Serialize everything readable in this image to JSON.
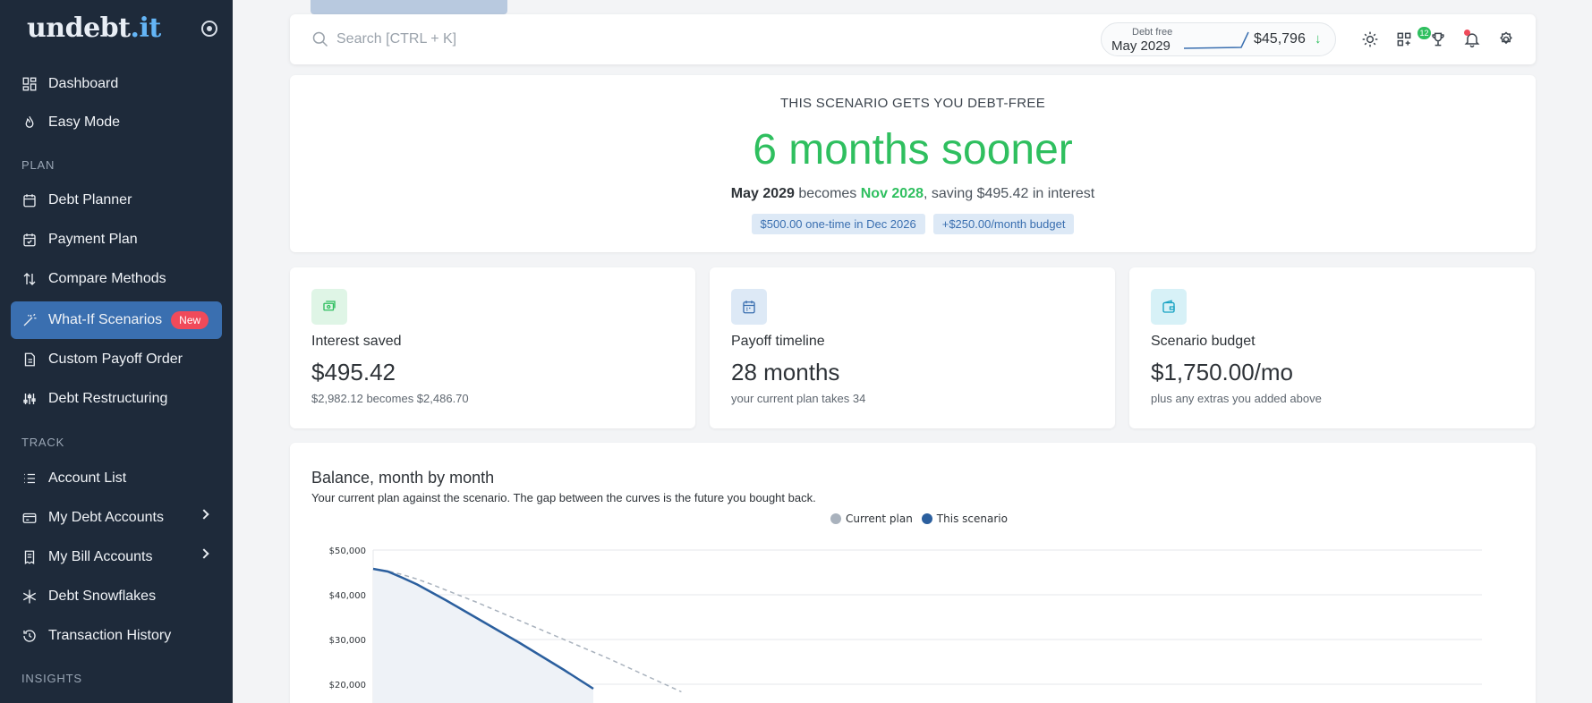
{
  "brand": {
    "name_main": "undebt",
    "name_accent": ".it"
  },
  "sidebar": {
    "items": [
      {
        "label": "Dashboard",
        "icon": "dashboard-icon"
      },
      {
        "label": "Easy Mode",
        "icon": "flame-icon"
      },
      {
        "label": "Debt Planner",
        "icon": "calendar-icon"
      },
      {
        "label": "Payment Plan",
        "icon": "calendar-check-icon"
      },
      {
        "label": "Compare Methods",
        "icon": "sort-arrows-icon"
      },
      {
        "label": "What-If Scenarios",
        "icon": "magic-wand-icon",
        "badge": "New",
        "active": true
      },
      {
        "label": "Custom Payoff Order",
        "icon": "document-icon"
      },
      {
        "label": "Debt Restructuring",
        "icon": "sliders-icon"
      },
      {
        "label": "Account List",
        "icon": "list-icon"
      },
      {
        "label": "My Debt Accounts",
        "icon": "credit-card-icon"
      },
      {
        "label": "My Bill Accounts",
        "icon": "receipt-icon"
      },
      {
        "label": "Debt Snowflakes",
        "icon": "snowflake-icon"
      },
      {
        "label": "Transaction History",
        "icon": "history-icon"
      }
    ],
    "sections": {
      "plan": "PLAN",
      "track": "TRACK",
      "insights": "INSIGHTS"
    }
  },
  "header": {
    "search_placeholder": "Search [CTRL + K]",
    "debt_free_label": "Debt free",
    "debt_free_date": "May 2029",
    "total_balance": "$45,796",
    "achievements_count": "12"
  },
  "hero": {
    "kicker": "THIS SCENARIO GETS YOU DEBT-FREE",
    "headline": "6 months sooner",
    "old_date": "May 2029",
    "becomes": " becomes ",
    "new_date": "Nov 2028",
    "saving_text": ", saving $495.42 in interest",
    "chips": [
      "$500.00 one-time in Dec 2026",
      "+$250.00/month budget"
    ]
  },
  "stats": [
    {
      "title": "Interest saved",
      "value": "$495.42",
      "sub": "$2,982.12 becomes $2,486.70",
      "icon": "money-icon",
      "color": "#2fbf5f",
      "bg": "#dff5e6"
    },
    {
      "title": "Payoff timeline",
      "value": "28 months",
      "sub": "your current plan takes 34",
      "icon": "calendar-icon",
      "color": "#3a6fb0",
      "bg": "#dde9f6"
    },
    {
      "title": "Scenario budget",
      "value": "$1,750.00/mo",
      "sub": "plus any extras you added above",
      "icon": "wallet-icon",
      "color": "#17a2c2",
      "bg": "#d7f1f7"
    }
  ],
  "chart_section": {
    "title": "Balance, month by month",
    "subtitle": "Your current plan against the scenario. The gap between the curves is the future you bought back."
  },
  "chart_data": {
    "type": "line",
    "ylim": [
      0,
      50000
    ],
    "yticks": [
      "$50,000",
      "$40,000",
      "$30,000",
      "$20,000"
    ],
    "ytick_values": [
      50000,
      40000,
      30000,
      20000
    ],
    "series": [
      {
        "name": "Current plan",
        "color": "#a9b2bd",
        "style": "dashed",
        "values": [
          45796,
          45300,
          44500,
          43500,
          42300,
          41000,
          39700,
          38400,
          37000,
          35600,
          34200,
          32800,
          31400,
          30000,
          28600,
          27200,
          25800,
          24300,
          22800,
          21300,
          19800,
          18300
        ]
      },
      {
        "name": "This scenario",
        "color": "#2b5f9e",
        "style": "solid",
        "values": [
          45796,
          45200,
          43800,
          42300,
          40500,
          38700,
          36800,
          34900,
          33000,
          31100,
          29200,
          27200,
          25200,
          23200,
          21100,
          19000
        ]
      }
    ]
  }
}
